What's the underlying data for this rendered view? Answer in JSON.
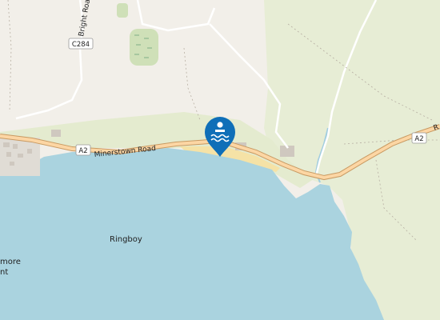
{
  "map": {
    "road_labels": {
      "c284": "C284",
      "bright_road": "Bright Road",
      "minerstown_road": "Minerstown Road",
      "a2_left": "A2",
      "a2_right": "A2",
      "right_road_partial": "R"
    },
    "place_labels": {
      "ringboy": "Ringboy",
      "more_partial": "more",
      "nt_partial": "nt"
    },
    "marker": {
      "icon": "swimming-icon",
      "color": "#0f6fb8"
    },
    "colors": {
      "sea": "#aad3df",
      "land": "#f2efe9",
      "grass": "#e6ecd4",
      "beach": "#f6e3a8",
      "primary_road": "#fcd6a4",
      "primary_casing": "#c99a62",
      "minor_road": "#ffffff",
      "water_stream": "#a2cde0"
    }
  }
}
